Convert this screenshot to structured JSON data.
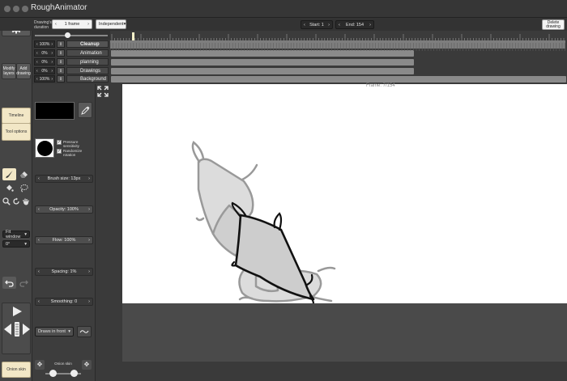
{
  "window": {
    "title": "RoughAnimator"
  },
  "top": {
    "drawing_duration_label": "Drawing's duration",
    "frames_value": "1 frame",
    "mode_select": "Independent",
    "start_label": "Start: 1",
    "end_label": "End: 154",
    "delete_drawing": "Delete drawing"
  },
  "left": {
    "modify_layers": "Modify layers",
    "add_drawing": "Add drawing",
    "timeline": "Timeline",
    "tool_options": "Tool options",
    "fit_window": "Fit window",
    "rotation": "0°",
    "onion_skin": "Onion skin"
  },
  "layers": [
    {
      "opacity": "100%",
      "name": "Cleanup",
      "selected": true
    },
    {
      "opacity": "0%",
      "name": "Animation",
      "selected": false
    },
    {
      "opacity": "0%",
      "name": "planning",
      "selected": false
    },
    {
      "opacity": "0%",
      "name": "Drawings",
      "selected": false
    },
    {
      "opacity": "100%",
      "name": "Background",
      "selected": false
    }
  ],
  "tools": {
    "pressure_sensitivity": "Pressure sensitivity",
    "randomize_rotation": "Randomize rotation",
    "brush_size": "Brush size: 13px",
    "opacity": "Opacity: 100%",
    "flow": "Flow: 100%",
    "spacing": "Spacing: 1%",
    "smoothing": "Smoothing: 0",
    "draw_mode": "Draws in front",
    "onion_skin": "Onion skin"
  },
  "canvas": {
    "frame_label": "Frame: 7/154"
  },
  "colors": {
    "accent_cream": "#f2e7c6",
    "canvas": "#ffffff",
    "track": "#8a8a8a"
  }
}
